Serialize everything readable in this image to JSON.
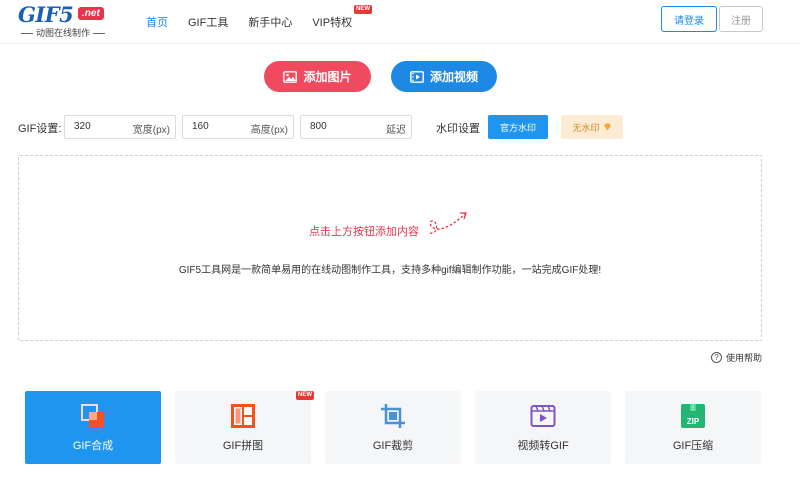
{
  "logo": {
    "text": "GIF5",
    "badge": ".net",
    "subtitle": "动图在线制作"
  },
  "nav": {
    "items": [
      {
        "label": "首页",
        "active": true
      },
      {
        "label": "GIF工具",
        "active": false
      },
      {
        "label": "新手中心",
        "active": false
      },
      {
        "label": "VIP特权",
        "active": false,
        "badge": "NEW"
      }
    ]
  },
  "auth": {
    "login": "请登录",
    "register": "注册"
  },
  "add": {
    "image_label": "添加图片",
    "video_label": "添加视频"
  },
  "settings": {
    "label": "GIF设置:",
    "width": {
      "value": "320",
      "unit": "宽度(px)"
    },
    "height": {
      "value": "160",
      "unit": "高度(px)"
    },
    "delay": {
      "value": "800",
      "unit": "延迟"
    },
    "watermark_label": "水印设置",
    "watermark_official": "官方水印",
    "watermark_none": "无水印"
  },
  "dropzone": {
    "hint": "点击上方按钮添加内容",
    "description": "GIF5工具网是一款简单易用的在线动图制作工具，支持多种gif编辑制作功能，一站完成GIF处理!"
  },
  "help": {
    "label": "使用帮助",
    "icon_glyph": "?"
  },
  "tools": [
    {
      "label": "GIF合成",
      "icon": "gif-compose-icon",
      "active": true
    },
    {
      "label": "GIF拼图",
      "icon": "gif-collage-icon",
      "active": false,
      "badge": "NEW"
    },
    {
      "label": "GIF裁剪",
      "icon": "crop-icon",
      "active": false
    },
    {
      "label": "视频转GIF",
      "icon": "video-to-gif-icon",
      "active": false
    },
    {
      "label": "GIF压缩",
      "icon": "zip-icon",
      "active": false,
      "icon_text": "ZIP"
    }
  ],
  "colors": {
    "accent": "#1e88e5",
    "pink": "#ef4a5e",
    "watermark_none_bg": "#fdebd3"
  }
}
